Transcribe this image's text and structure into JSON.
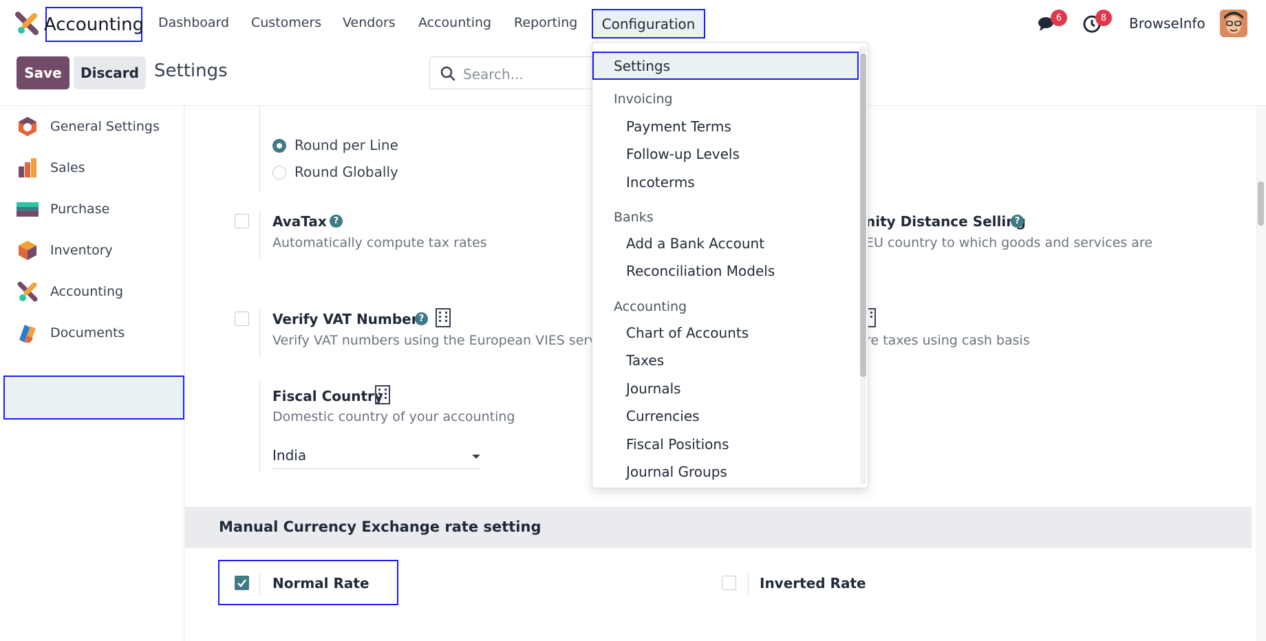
{
  "app": {
    "title": "Accounting",
    "menu": [
      "Dashboard",
      "Customers",
      "Vendors",
      "Accounting",
      "Reporting"
    ],
    "active_menu": "Configuration",
    "messages_badge": "6",
    "activities_badge": "8",
    "company": "BrowseInfo"
  },
  "control_panel": {
    "save_label": "Save",
    "discard_label": "Discard",
    "page_title": "Settings",
    "search_placeholder": "Search..."
  },
  "sidebar": {
    "items": [
      {
        "label": "General Settings",
        "icon": "general-settings-icon"
      },
      {
        "label": "Sales",
        "icon": "sales-icon"
      },
      {
        "label": "Purchase",
        "icon": "purchase-icon"
      },
      {
        "label": "Inventory",
        "icon": "inventory-icon"
      },
      {
        "label": "Accounting",
        "icon": "accounting-icon"
      },
      {
        "label": "Documents",
        "icon": "documents-icon"
      }
    ],
    "active": "Accounting"
  },
  "settings": {
    "round_per_line": "Round per Line",
    "round_globally": "Round Globally",
    "avatax_label": "AvaTax",
    "avatax_desc": "Automatically compute tax rates",
    "eu_label": "nity Distance Selling",
    "eu_desc": "EU country to which goods and services are",
    "vat_label": "Verify VAT Numbers",
    "vat_desc": "Verify VAT numbers using the European VIES serv",
    "cash_desc": "re taxes using cash basis",
    "fiscal_label": "Fiscal Country",
    "fiscal_desc": "Domestic country of your accounting",
    "fiscal_value": "India",
    "section_title": "Manual Currency Exchange rate setting",
    "normal_rate": "Normal Rate",
    "inverted_rate": "Inverted Rate"
  },
  "dropdown": {
    "settings": "Settings",
    "invoicing_header": "Invoicing",
    "invoicing_items": [
      "Payment Terms",
      "Follow-up Levels",
      "Incoterms"
    ],
    "banks_header": "Banks",
    "banks_items": [
      "Add a Bank Account",
      "Reconciliation Models"
    ],
    "accounting_header": "Accounting",
    "accounting_items": [
      "Chart of Accounts",
      "Taxes",
      "Journals",
      "Currencies",
      "Fiscal Positions",
      "Journal Groups"
    ]
  },
  "colors": {
    "brand": "#714b67",
    "accent": "#3f7a86",
    "highlight_border": "#1a1aff",
    "badge": "#e0384b"
  }
}
